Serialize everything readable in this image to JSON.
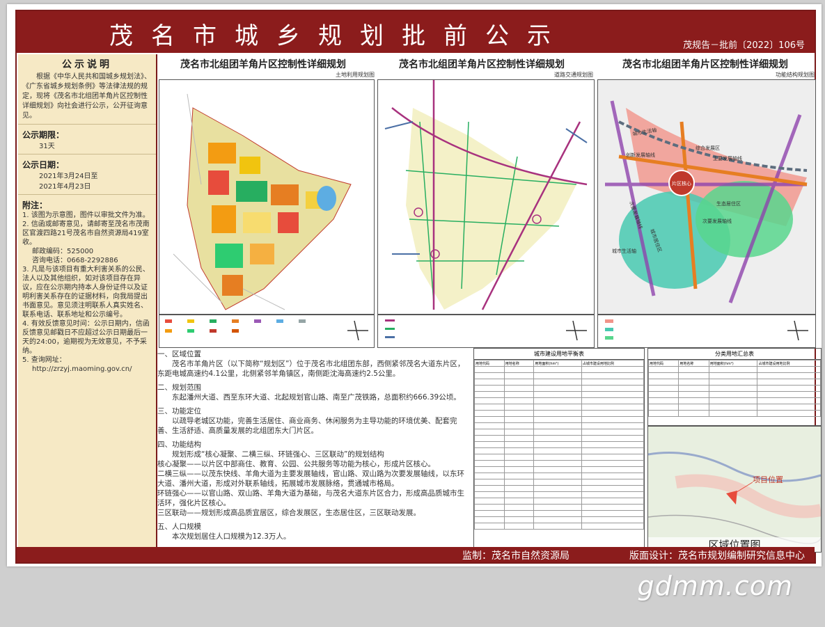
{
  "header": {
    "title": "茂名市城乡规划批前公示",
    "doc_number": "茂规告－批前〔2022〕106号"
  },
  "sidebar": {
    "heading": "公示说明",
    "intro": "根据《中华人民共和国城乡规划法》、《广东省城乡规划条例》等法律法规的规定，现将《茂名市北组团羊角片区控制性详细规划》向社会进行公示，公开征询意见。",
    "period_label": "公示期限：",
    "period_value": "31天",
    "dates_label": "公示日期：",
    "date_start": "2021年3月24日至",
    "date_end": "2021年4月23日",
    "notes_label": "附注：",
    "notes": [
      "1. 该图为示意图，图件以审批文件为准。",
      "2. 信函或邮寄意见，请邮寄至茂名市茂南区官渡四路21号茂名市自然资源局419室收。",
      "邮政编码：525000",
      "咨询电话：0668-2292886",
      "3. 凡是与该项目有重大利害关系的公民、法人以及其他组织，如对该项目存在异议，应在公示期内持本人身份证件以及证明利害关系存在的证据材料，向我局提出书面意见。意见须注明联系人真实姓名、联系电话、联系地址和公示编号。",
      "4. 有效反馈意见时间：公示日期内，信函反馈意见邮戳日不应超过公示日期最后一天的24:00，逾期视为无效意见，不予采纳。",
      "5. 查询网址：",
      "http://zrzyj.maoming.gov.cn/"
    ]
  },
  "maps": [
    {
      "title": "茂名市北组团羊角片区控制性详细规划",
      "subtitle": "土地利用规划图"
    },
    {
      "title": "茂名市北组团羊角片区控制性详细规划",
      "subtitle": "道路交通规划图"
    },
    {
      "title": "茂名市北组团羊角片区控制性详细规划",
      "subtitle": "功能结构规划图"
    }
  ],
  "map3_labels": [
    "城市生活轴",
    "创新发展轴线",
    "综合发展区",
    "主要发展轴线",
    "片区核心",
    "生态居住区",
    "次要发展轴线",
    "城市居住区",
    "次要发展轴线",
    "城市生活轴"
  ],
  "text": {
    "s1_title": "一、区域位置",
    "s1_body": "茂名市羊角片区（以下简称“规划区”）位于茂名市北组团东部，西侧紧邻茂名大道东片区，东距电城高速约4.1公里，北侧紧邻羊角镇区，南侧距沈海高速约2.5公里。",
    "s2_title": "二、规划范围",
    "s2_body": "东起潘州大道、西至东环大道、北起规划官山路、南至广茂铁路，总面积约666.39公顷。",
    "s3_title": "三、功能定位",
    "s3_body": "以疏导老城区功能，完善生活居住、商业商务、休闲服务为主导功能的环境优美、配套完善、生活舒适、高质量发展的北组团东大门片区。",
    "s4_title": "四、功能结构",
    "s4_body": "规划形成“核心凝聚、二横三纵、环链强心、三区联动”的规划结构",
    "s4_items": [
      "核心凝聚——以片区中部商住、教育、公园、公共服务等功能为核心，形成片区核心。",
      "二横三纵——以茂东快线、羊角大道为主要发展轴线，官山路、双山路为次要发展轴线，以东环大道、潘州大道，形成对外联系轴线，拓展城市发展脉络，贯通城市格局。",
      "环链强心——以官山路、双山路、羊角大道为基础，与茂名大道东片区合力，形成高品质城市生活环，强化片区核心。",
      "三区联动——规划形成高品质宜居区，综合发展区，生态居住区，三区联动发展。"
    ],
    "s5_title": "五、人口规模",
    "s5_body": "本次规划居住人口规模为12.3万人。"
  },
  "table1": {
    "title": "城市建设用地平衡表",
    "headers": [
      "用地代码",
      "用地名称",
      "用地面积(hm²)",
      "占城市建设用地比例"
    ]
  },
  "table2": {
    "title": "分类用地汇总表",
    "headers": [
      "用地代码",
      "用地名称",
      "用地面积(hm²)",
      "占城市建设用地比例"
    ]
  },
  "location": {
    "title": "区域位置图",
    "marker_label": "项目位置"
  },
  "footer": {
    "supervisor": "监制：茂名市自然资源局",
    "designer": "版面设计：茂名市规划编制研究信息中心"
  },
  "watermark": "gdmm.com",
  "colors": {
    "banner": "#8b1c1c",
    "sidebar_bg": "#f6e9c5"
  }
}
